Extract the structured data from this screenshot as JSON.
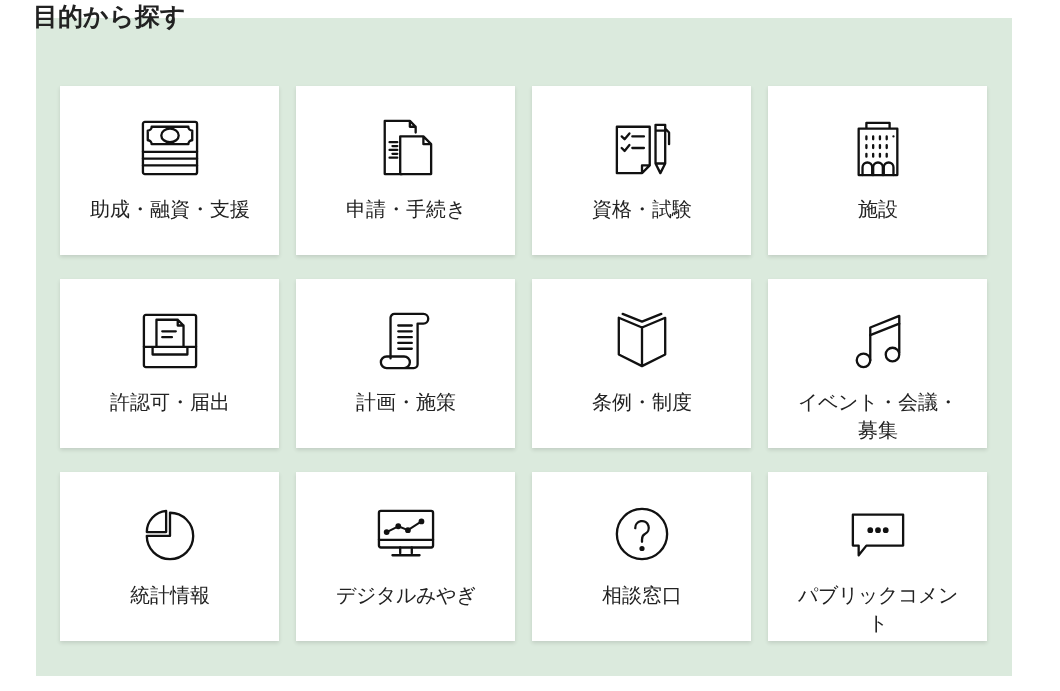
{
  "title": "目的から探す",
  "items": [
    {
      "label": "助成・融資・支援"
    },
    {
      "label": "申請・手続き"
    },
    {
      "label": "資格・試験"
    },
    {
      "label": "施設"
    },
    {
      "label": "許認可・届出"
    },
    {
      "label": "計画・施策"
    },
    {
      "label": "条例・制度"
    },
    {
      "label": "イベント・会議・募集"
    },
    {
      "label": "統計情報"
    },
    {
      "label": "デジタルみやぎ"
    },
    {
      "label": "相談窓口"
    },
    {
      "label": "パブリックコメント"
    }
  ]
}
